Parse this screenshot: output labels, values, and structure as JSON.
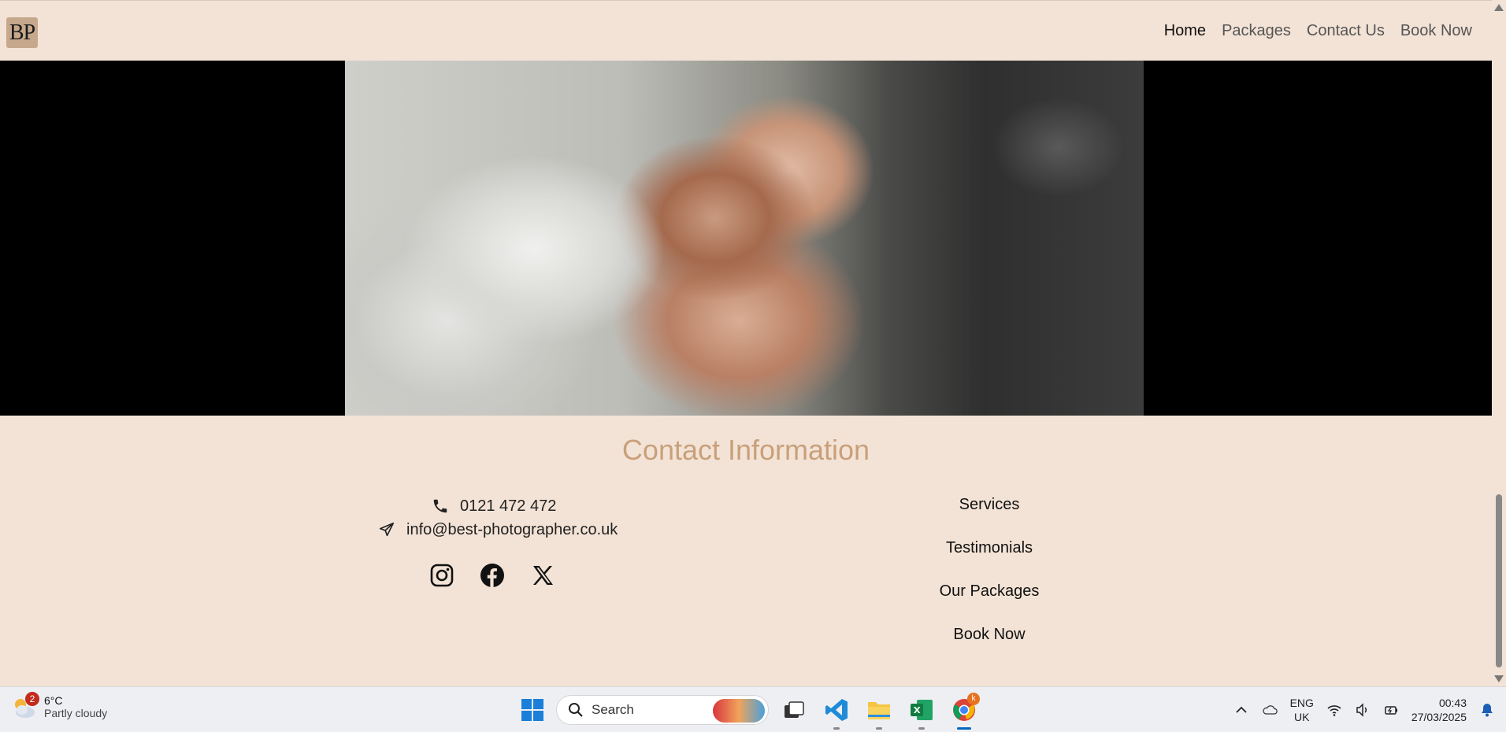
{
  "navbar": {
    "logo_text": "BP",
    "links": [
      {
        "label": "Home"
      },
      {
        "label": "Packages"
      },
      {
        "label": "Contact Us"
      },
      {
        "label": "Book Now"
      }
    ]
  },
  "contact": {
    "title": "Contact Information",
    "phone": "0121 472 472",
    "email": "info@best-photographer.co.uk",
    "socials": [
      "instagram-icon",
      "facebook-icon",
      "x-icon"
    ]
  },
  "footer_links": [
    {
      "label": "Services"
    },
    {
      "label": "Testimonials"
    },
    {
      "label": "Our Packages"
    },
    {
      "label": "Book Now"
    }
  ],
  "taskbar": {
    "weather": {
      "badge": "2",
      "temp": "6°C",
      "desc": "Partly cloudy"
    },
    "search_placeholder": "Search",
    "chrome_badge": "k",
    "language": {
      "line1": "ENG",
      "line2": "UK"
    },
    "clock": {
      "time": "00:43",
      "date": "27/03/2025"
    }
  },
  "colors": {
    "page_bg": "#f3e3d6",
    "title_accent": "#c8a07a",
    "logo_bg": "#c6a88c"
  }
}
